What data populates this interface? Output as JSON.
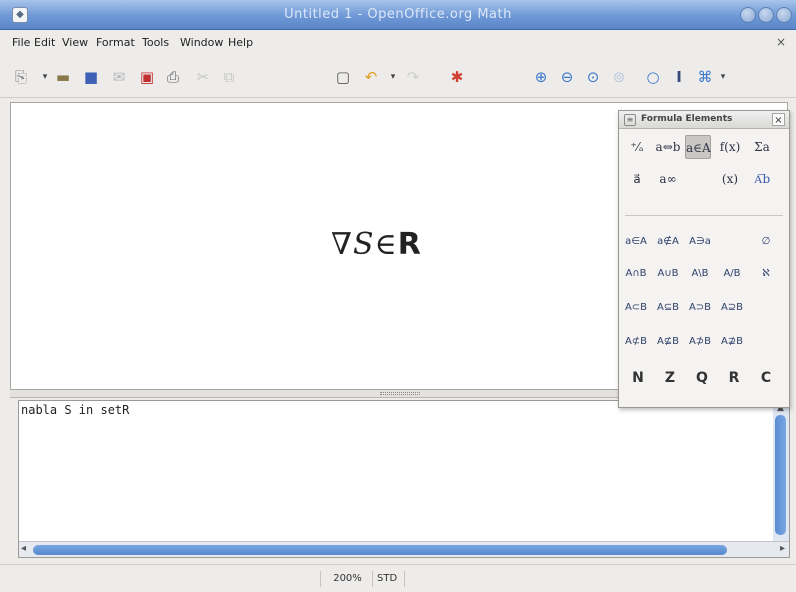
{
  "window": {
    "title": "Untitled 1 - OpenOffice.org Math"
  },
  "menu": {
    "file": "File",
    "edit": "Edit",
    "view": "View",
    "format": "Format",
    "tools": "Tools",
    "window": "Window",
    "help": "Help",
    "close_doc": "×"
  },
  "toolbar": {
    "buttons": [
      "new-icon",
      "open-icon",
      "save-icon",
      "email-icon",
      "pdf-icon",
      "print-icon",
      "cut-icon",
      "copy-icon",
      "undo-icon",
      "redo-icon",
      "update-icon",
      "zoom-in-icon",
      "zoom-out-icon",
      "zoom-100-icon",
      "show-all-icon",
      "zoom-icon",
      "formula-cursor-icon",
      "symbols-icon"
    ]
  },
  "formula": {
    "nabla": "∇",
    "s": "S",
    "in": "∈",
    "r": "R"
  },
  "command": {
    "text": "nabla S in setR"
  },
  "statusbar": {
    "zoom": "200%",
    "mode": "STD"
  },
  "elements_panel": {
    "title": "Formula Elements",
    "categories": {
      "unary_binary": "⁺⁄ₐ",
      "relations": "a⇔b",
      "set_ops": "a∈A",
      "functions": "f(x)",
      "operators": "Σa",
      "attributes": "a⃗",
      "others": "a∞",
      "brackets": "(x)",
      "formats": "A͞b"
    },
    "rows": [
      [
        "a∈A",
        "a∉A",
        "A∋a",
        "",
        "∅"
      ],
      [
        "A∩B",
        "A∪B",
        "A\\B",
        "A/B",
        "ℵ"
      ],
      [
        "A⊂B",
        "A⊆B",
        "A⊃B",
        "A⊇B",
        ""
      ],
      [
        "A⊄B",
        "A⊈B",
        "A⊅B",
        "A⊉B",
        ""
      ],
      [
        "N",
        "Z",
        "Q",
        "R",
        "C"
      ]
    ]
  }
}
